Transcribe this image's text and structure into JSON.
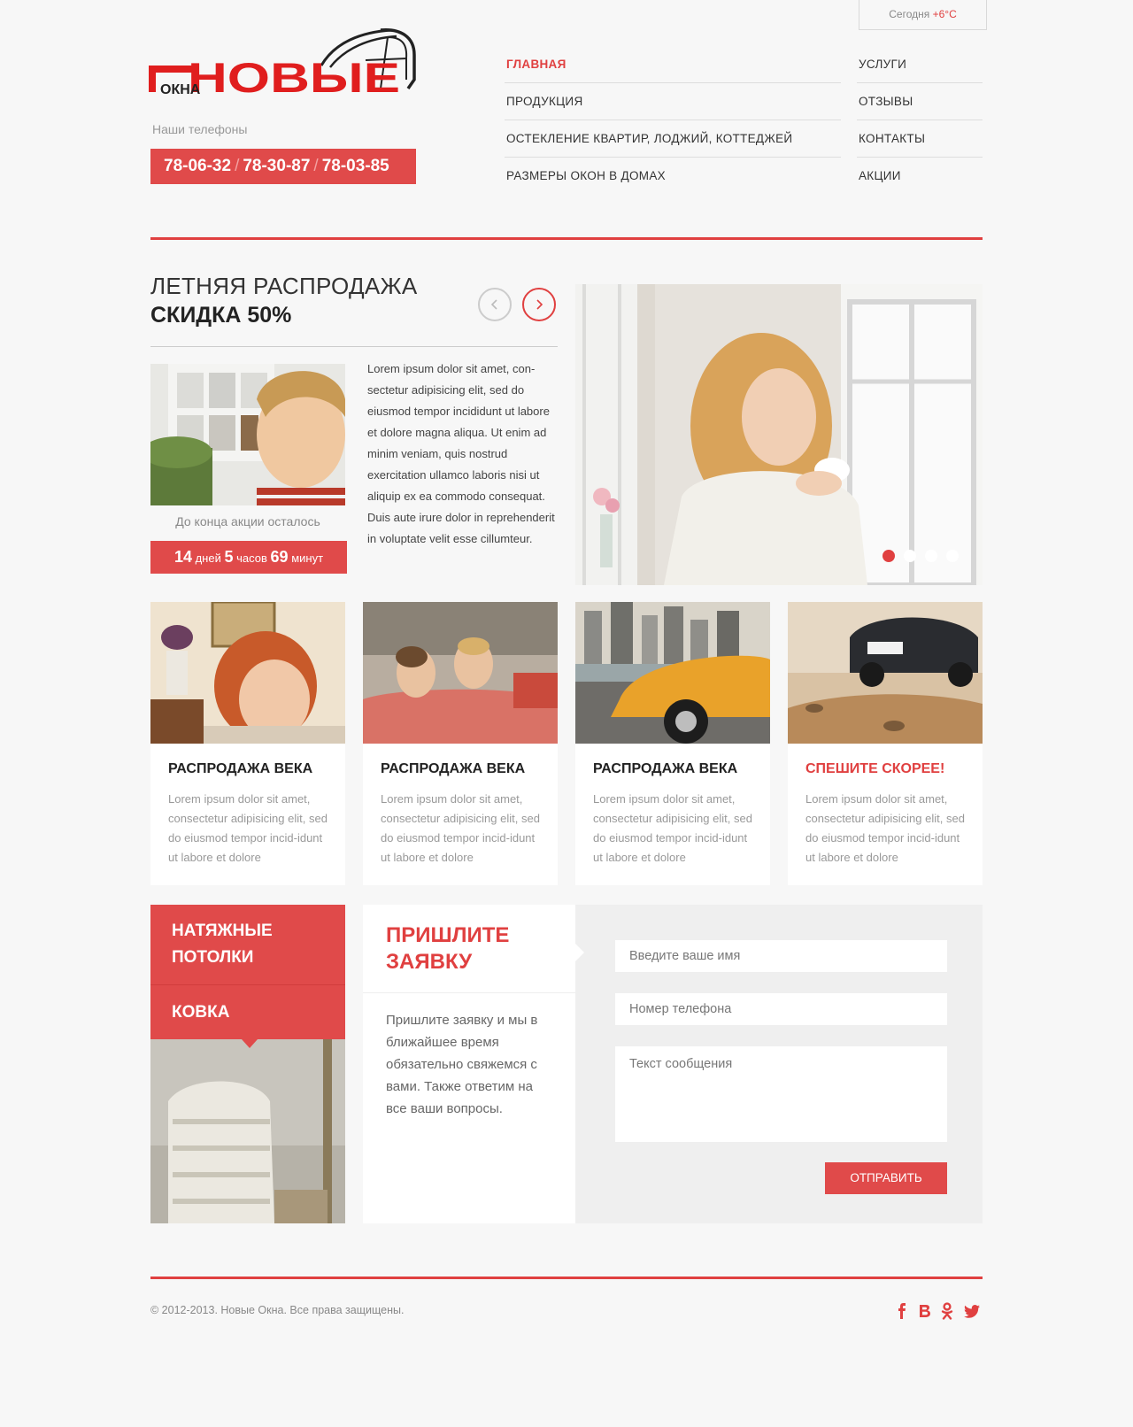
{
  "weather": {
    "label": "Сегодня",
    "temp": "+6°C"
  },
  "logo": {
    "main": "НОВЫЕ",
    "sub": "ОКНА"
  },
  "phones": {
    "label": "Наши телефоны",
    "numbers": [
      "78-06-32",
      "78-30-87",
      "78-03-85"
    ],
    "separator": "/"
  },
  "nav": {
    "left": [
      "ГЛАВНАЯ",
      "ПРОДУКЦИЯ",
      "ОСТЕКЛЕНИЕ КВАРТИР, ЛОДЖИЙ, КОТТЕДЖЕЙ",
      "РАЗМЕРЫ ОКОН В ДОМАХ"
    ],
    "right": [
      "УСЛУГИ",
      "ОТЗЫВЫ",
      "КОНТАКТЫ",
      "АКЦИИ"
    ],
    "active": "ГЛАВНАЯ"
  },
  "promo": {
    "title": "ЛЕТНЯЯ РАСПРОДАЖА",
    "subtitle": "СКИДКА 50%",
    "countdown_label": "До конца акции осталось",
    "countdown": {
      "days": "14",
      "days_label": "дней",
      "hours": "5",
      "hours_label": "часов",
      "minutes": "69",
      "minutes_label": "минут"
    },
    "text": "Lorem ipsum dolor sit amet, con-sectetur adipisicing elit, sed do eiusmod tempor incididunt ut labore et dolore magna aliqua. Ut enim ad minim veniam, quis nostrud exercitation ullamco laboris nisi ut aliquip ex ea commodo consequat. Duis aute irure dolor in reprehenderit in voluptate velit esse cillumteur."
  },
  "slider": {
    "slides": 4,
    "active_index": 0
  },
  "cards": [
    {
      "title": "РАСПРОДАЖА ВЕКА",
      "text": "Lorem ipsum dolor sit amet, consectetur adipisicing elit, sed do eiusmod tempor incid-idunt ut labore et dolore",
      "highlight": false
    },
    {
      "title": "РАСПРОДАЖА ВЕКА",
      "text": "Lorem ipsum dolor sit amet, consectetur adipisicing elit, sed do eiusmod tempor incid-idunt ut labore et dolore",
      "highlight": false
    },
    {
      "title": "РАСПРОДАЖА ВЕКА",
      "text": "Lorem ipsum dolor sit amet, consectetur adipisicing elit, sed do eiusmod tempor incid-idunt ut labore et dolore",
      "highlight": false
    },
    {
      "title": "СПЕШИТЕ СКОРЕЕ!",
      "text": "Lorem ipsum dolor sit amet, consectetur adipisicing elit, sed do eiusmod tempor incid-idunt ut labore et dolore",
      "highlight": true
    }
  ],
  "side_menu": [
    "НАТЯЖНЫЕ ПОТОЛКИ",
    "КОВКА"
  ],
  "request": {
    "title": "ПРИШЛИТЕ ЗАЯВКУ",
    "text": "Пришлите заявку и мы в ближайшее время обязательно свяжемся с вами. Также ответим на все ваши вопросы."
  },
  "form": {
    "name_placeholder": "Введите ваше имя",
    "phone_placeholder": "Номер телефона",
    "message_placeholder": "Текст сообщения",
    "submit_label": "ОТПРАВИТЬ"
  },
  "footer": {
    "copyright": "© 2012-2013. Новые Окна. Все права защищены."
  },
  "social_icons": [
    "facebook-icon",
    "vkontakte-icon",
    "odnoklassniki-icon",
    "twitter-icon"
  ],
  "colors": {
    "accent": "#e04a4a",
    "background": "#f7f7f7"
  }
}
